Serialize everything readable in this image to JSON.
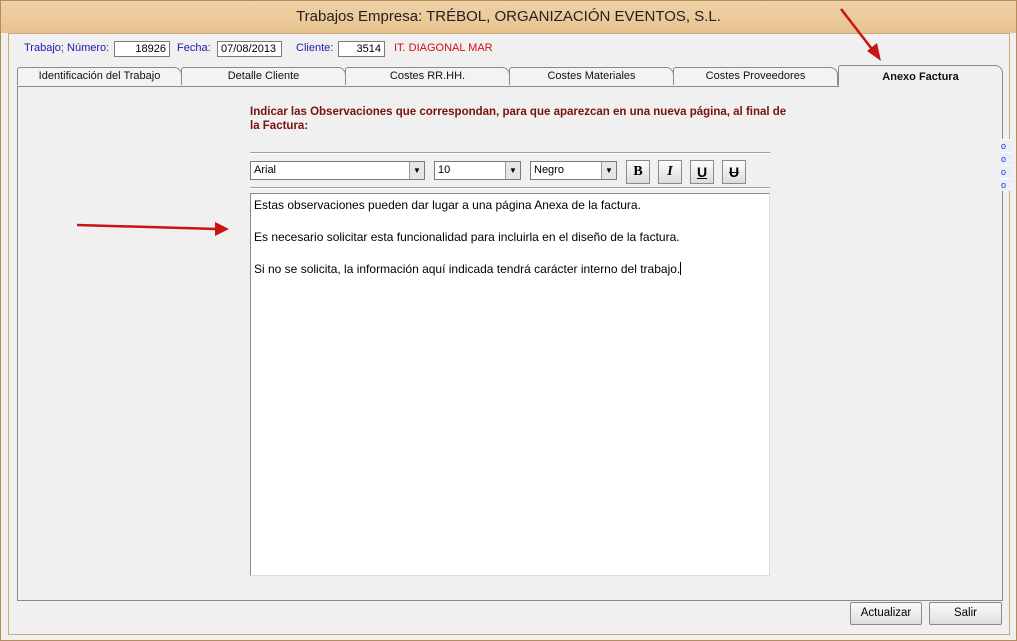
{
  "window": {
    "title": "Trabajos Empresa: TRÉBOL, ORGANIZACIÓN EVENTOS, S.L."
  },
  "header": {
    "trabajo_label": "Trabajo; Número:",
    "trabajo_value": "18926",
    "fecha_label": "Fecha:",
    "fecha_value": "07/08/2013",
    "cliente_label": "Cliente:",
    "cliente_value": "3514",
    "cliente_name": "IT. DIAGONAL MAR"
  },
  "tabs": [
    {
      "label": "Identificación del Trabajo"
    },
    {
      "label": "Detalle Cliente"
    },
    {
      "label": "Costes RR.HH."
    },
    {
      "label": "Costes Materiales"
    },
    {
      "label": "Costes Proveedores"
    },
    {
      "label": "Anexo Factura",
      "active": true
    }
  ],
  "panel": {
    "instruction": "Indicar las Observaciones que correspondan,  para que aparezcan en una nueva página, al final de la Factura:",
    "font_value": "Arial",
    "size_value": "10",
    "color_value": "Negro",
    "bold_label": "B",
    "italic_label": "I",
    "underline_label": "U",
    "strike_label": "U",
    "editor_lines": [
      "Estas observaciones pueden dar lugar a una página Anexa de la factura.",
      "Es necesario solicitar esta funcionalidad para incluirla en el diseño de la factura.",
      "Si no se solicita, la información aquí indicada tendrá carácter interno del trabajo."
    ]
  },
  "side_links": [
    "o",
    "o",
    "o",
    "o"
  ],
  "footer": {
    "update_label": "Actualizar",
    "exit_label": "Salir"
  },
  "colors": {
    "title_bg": "#e8c38f",
    "label_blue": "#1a1ab0",
    "client_red": "#d01010",
    "instruction": "#7a1010",
    "annotation_arrow": "#c81414"
  }
}
